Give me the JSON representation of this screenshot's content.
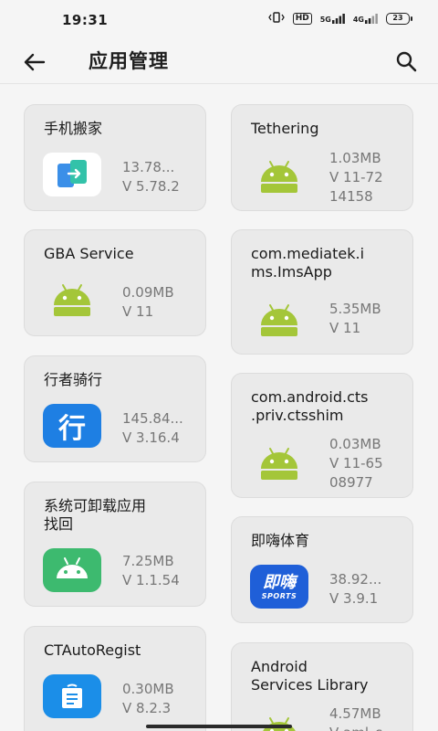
{
  "status": {
    "time": "19:31",
    "hd_label": "HD",
    "net1": "5G",
    "net2": "4G",
    "battery": "23"
  },
  "header": {
    "title": "应用管理"
  },
  "apps": [
    {
      "name": "手机搬家",
      "size": "13.78...",
      "version": "V 5.78.2",
      "icon": "phone-clone-icon"
    },
    {
      "name": "Tethering",
      "size": "1.03MB",
      "version": "V 11-72",
      "version2": "14158",
      "icon": "android-icon"
    },
    {
      "name": "GBA Service",
      "size": "0.09MB",
      "version": "V 11",
      "icon": "android-icon"
    },
    {
      "name": "com.mediatek.i",
      "name2": "ms.ImsApp",
      "size": "5.35MB",
      "version": "V 11",
      "icon": "android-icon"
    },
    {
      "name": "行者骑行",
      "size": "145.84...",
      "version": "V 3.16.4",
      "icon": "xingzhe-icon",
      "icon_glyph": "行"
    },
    {
      "name": "com.android.cts",
      "name2": ".priv.ctsshim",
      "size": "0.03MB",
      "version": "V 11-65",
      "version2": "08977",
      "icon": "android-icon"
    },
    {
      "name": "系统可卸载应用",
      "name2": "找回",
      "size": "7.25MB",
      "version": "V 1.1.54",
      "icon": "android-green-icon"
    },
    {
      "name": "即嗨体育",
      "size": "38.92...",
      "version": "V 3.9.1",
      "icon": "jihai-sports-icon",
      "icon_glyph": "即嗨",
      "icon_sub": "SPORTS"
    },
    {
      "name": "CTAutoRegist",
      "size": "0.30MB",
      "version": "V 8.2.3",
      "icon": "ct-icon"
    },
    {
      "name": "Android",
      "name2": "Services Library",
      "size": "4.57MB",
      "version": "V aml_s",
      "icon": "android-icon"
    }
  ],
  "colors": {
    "android_green": "#a4c639",
    "android_tile_green": "#3dba6f",
    "xingzhe_blue": "#1e7fe3",
    "jihai_blue": "#1f5fd8",
    "ct_blue": "#1b8ee8"
  }
}
